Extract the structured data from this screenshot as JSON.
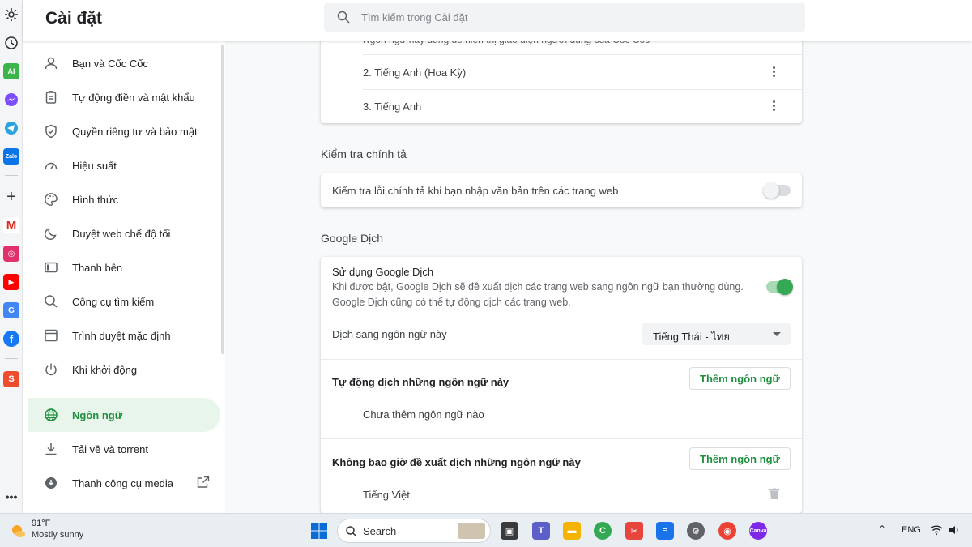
{
  "header": {
    "title": "Cài đặt",
    "search_placeholder": "Tìm kiếm trong Cài đặt"
  },
  "sidebar": {
    "items": [
      {
        "label": "Bạn và Cốc Cốc",
        "icon": "person-icon"
      },
      {
        "label": "Tự động điền và mật khẩu",
        "icon": "clipboard-icon"
      },
      {
        "label": "Quyền riêng tư và bảo mật",
        "icon": "shield-icon"
      },
      {
        "label": "Hiệu suất",
        "icon": "speedometer-icon"
      },
      {
        "label": "Hình thức",
        "icon": "palette-icon"
      },
      {
        "label": "Duyệt web chế độ tối",
        "icon": "moon-icon"
      },
      {
        "label": "Thanh bên",
        "icon": "sidebar-panel-icon"
      },
      {
        "label": "Công cụ tìm kiếm",
        "icon": "search-icon"
      },
      {
        "label": "Trình duyệt mặc định",
        "icon": "browser-window-icon"
      },
      {
        "label": "Khi khởi động",
        "icon": "power-icon"
      },
      {
        "label": "Ngôn ngữ",
        "icon": "globe-icon",
        "active": true
      },
      {
        "label": "Tải về và torrent",
        "icon": "download-icon"
      },
      {
        "label": "Thanh công cụ media",
        "icon": "media-download-icon"
      }
    ]
  },
  "languages_card": {
    "cut_text": "Ngôn ngữ này dùng để hiển thị giao diện người dùng của Cốc Cốc",
    "items": [
      "2. Tiếng Anh (Hoa Kỳ)",
      "3. Tiếng Anh"
    ]
  },
  "spellcheck": {
    "section_title": "Kiểm tra chính tả",
    "row_label": "Kiểm tra lỗi chính tả khi bạn nhập văn bản trên các trang web",
    "enabled": false
  },
  "google_translate": {
    "section_title": "Google Dịch",
    "use_title": "Sử dụng Google Dịch",
    "use_desc_1": "Khi được bật, Google Dịch sẽ đề xuất dịch các trang web sang ngôn ngữ bạn thường dùng.",
    "use_desc_2": "Google Dịch cũng có thể tự động dịch các trang web.",
    "enabled": true,
    "target_label": "Dịch sang ngôn ngữ này",
    "target_value": "Tiếng Thái - ไทย",
    "auto_title": "Tự động dịch những ngôn ngữ này",
    "add_button": "Thêm ngôn ngữ",
    "auto_empty": "Chưa thêm ngôn ngữ nào",
    "never_title": "Không bao giờ đề xuất dịch những ngôn ngữ này",
    "never_item": "Tiếng Việt"
  },
  "taskbar": {
    "temp": "91°F",
    "weather": "Mostly sunny",
    "search_label": "Search",
    "lang": "ENG"
  },
  "colors": {
    "accent_green": "#1e8e3e",
    "toggle_on": "#34a853"
  }
}
